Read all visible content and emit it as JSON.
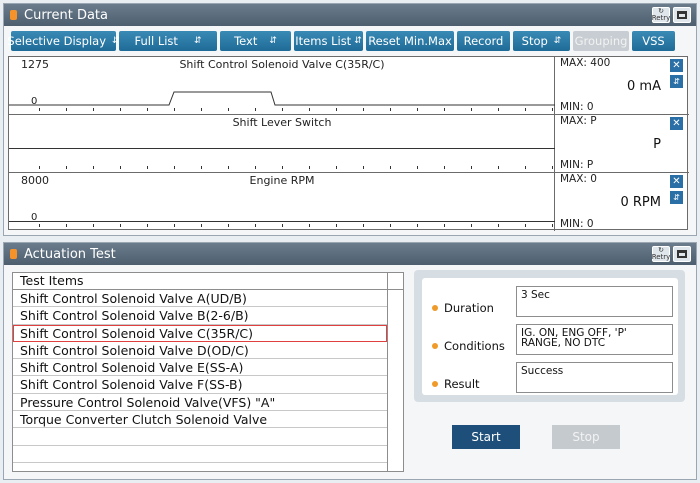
{
  "current_data": {
    "title": "Current Data",
    "retry_label": "Retry",
    "toolbar": {
      "selective_display": "Selective Display",
      "full_list": "Full List",
      "text": "Text",
      "items_list": "Items List",
      "reset_minmax": "Reset Min.Max",
      "record": "Record",
      "stop": "Stop",
      "grouping": "Grouping",
      "vss": "VSS"
    },
    "graphs": [
      {
        "name": "Shift Control Solenoid Valve C(35R/C)",
        "left_max": "1275",
        "left_zero": "0",
        "max": "MAX: 400",
        "value": "0 mA",
        "min": "MIN: 0"
      },
      {
        "name": "Shift Lever Switch",
        "left_max": "",
        "left_zero": "",
        "max": "MAX: P",
        "value": "P",
        "min": "MIN: P"
      },
      {
        "name": "Engine RPM",
        "left_max": "8000",
        "left_zero": "0",
        "max": "MAX: 0",
        "value": "0 RPM",
        "min": "MIN: 0"
      }
    ]
  },
  "actuation_test": {
    "title": "Actuation Test",
    "retry_label": "Retry",
    "list_header": "Test Items",
    "items": [
      "Shift Control Solenoid Valve A(UD/B)",
      "Shift Control Solenoid Valve B(2-6/B)",
      "Shift Control Solenoid Valve C(35R/C)",
      "Shift Control Solenoid Valve D(OD/C)",
      "Shift Control Solenoid Valve E(SS-A)",
      "Shift Control Solenoid Valve F(SS-B)",
      "Pressure Control Solenoid Valve(VFS) \"A\"",
      "Torque Converter Clutch Solenoid Valve"
    ],
    "selected_index": 2,
    "duration_label": "Duration",
    "duration_value": "3 Sec",
    "conditions_label": "Conditions",
    "conditions_value": "IG. ON, ENG OFF, 'P' RANGE, NO DTC",
    "result_label": "Result",
    "result_value": "Success",
    "start_label": "Start",
    "stop_label": "Stop"
  },
  "colors": {
    "accent": "#2a6fa6",
    "title_bar": "#566878",
    "selected_outline": "#e04040",
    "bullet": "#f09a2a"
  }
}
